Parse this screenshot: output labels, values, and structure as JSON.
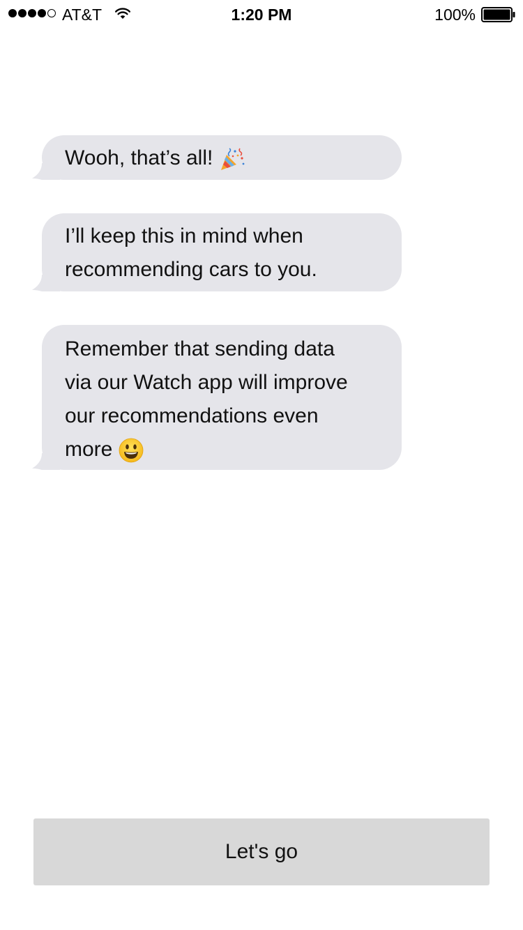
{
  "status_bar": {
    "signal_bars_filled": 4,
    "signal_bars_total": 5,
    "carrier": "AT&T",
    "wifi_icon": "wifi-icon",
    "time": "1:20 PM",
    "battery_percent": "100%",
    "battery_level": 1.0,
    "battery_icon": "battery-full-icon"
  },
  "messages": [
    {
      "lines": [
        "Wooh, that’s all!"
      ],
      "emoji": "party-popper-icon"
    },
    {
      "lines": [
        "I’ll keep this in mind when",
        "recommending cars to you."
      ]
    },
    {
      "lines": [
        "Remember that sending data",
        "via our Watch app will improve",
        "our recommendations even",
        "more"
      ],
      "emoji": "smiling-face-icon"
    }
  ],
  "bubble_color": "#e5e5ea",
  "cta": {
    "label": "Let's go",
    "background": "#d8d8d8"
  }
}
